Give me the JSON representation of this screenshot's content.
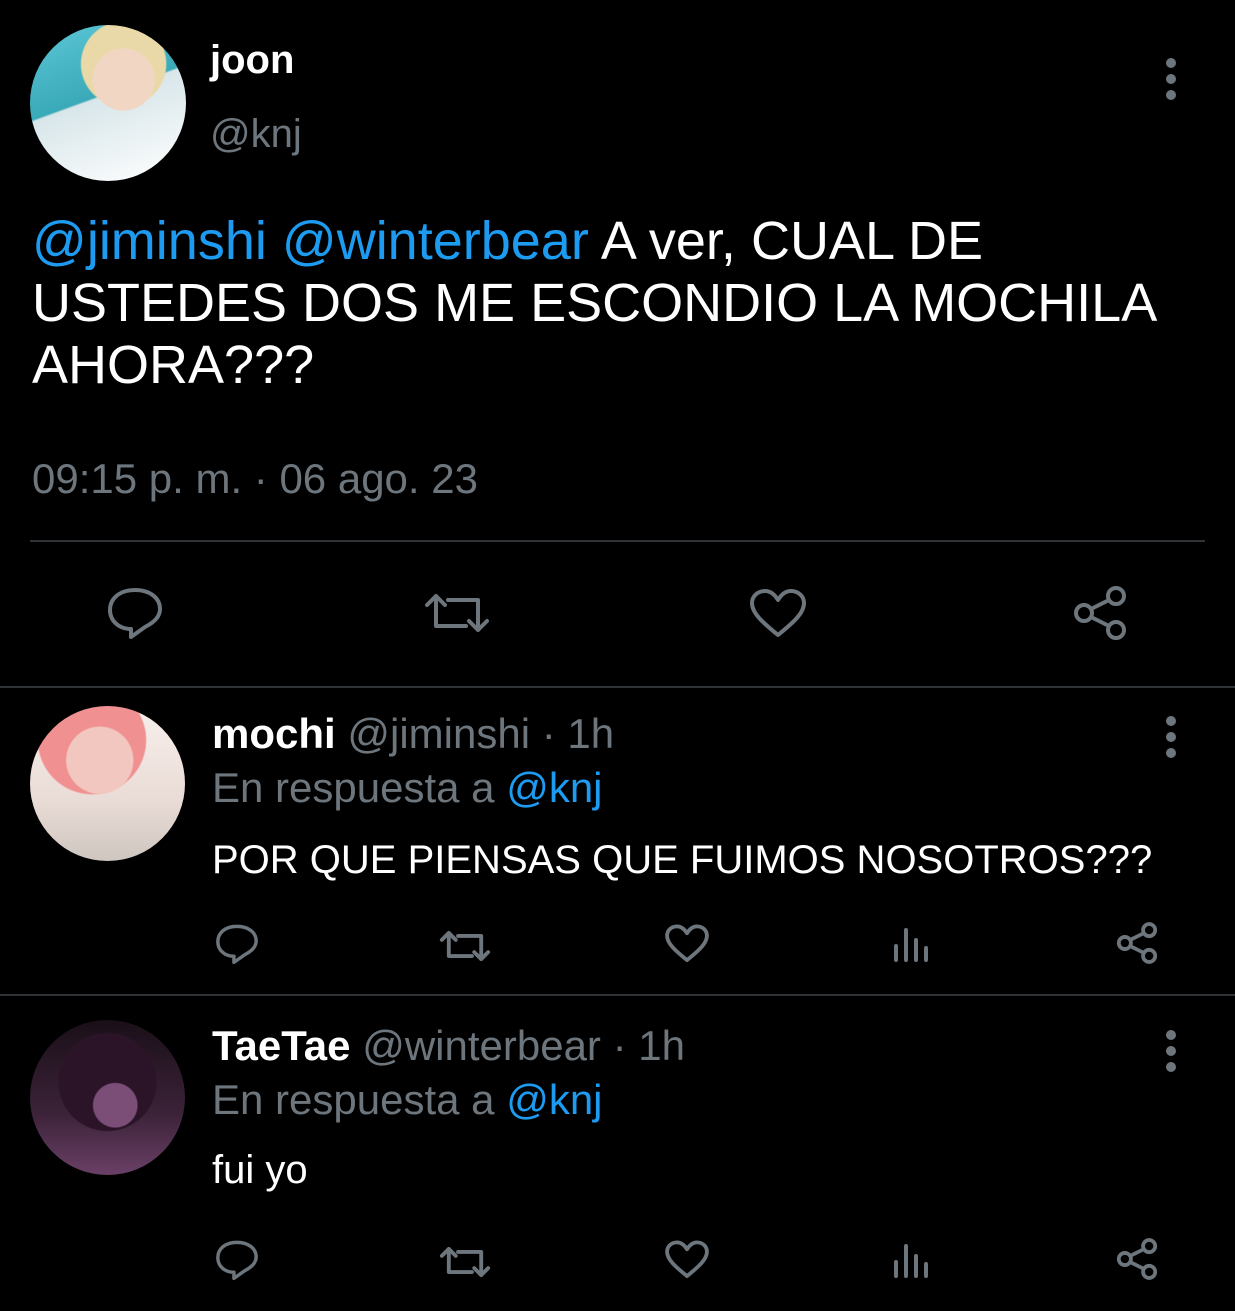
{
  "main_tweet": {
    "display_name": "joon",
    "handle": "@knj",
    "mentions": [
      "@jiminshi",
      "@winterbear"
    ],
    "text": "A ver, CUAL DE USTEDES DOS ME ESCONDIO LA MOCHILA AHORA???",
    "timestamp": "09:15 p. m. · 06 ago. 23"
  },
  "replies": [
    {
      "display_name": "mochi",
      "handle": "@jiminshi",
      "age": "· 1h",
      "reply_prefix": "En respuesta a",
      "reply_to": "@knj",
      "text": "POR QUE PIENSAS QUE FUIMOS NOSOTROS???"
    },
    {
      "display_name": "TaeTae",
      "handle": "@winterbear",
      "age": "· 1h",
      "reply_prefix": "En respuesta a",
      "reply_to": "@knj",
      "text": "fui yo"
    }
  ],
  "colors": {
    "background": "#000000",
    "text": "#ffffff",
    "link": "#1d9bf0",
    "muted": "#6e767d",
    "divider": "#2f3336"
  },
  "icons": [
    "reply-icon",
    "retweet-icon",
    "like-icon",
    "views-icon",
    "share-icon",
    "more-icon"
  ]
}
